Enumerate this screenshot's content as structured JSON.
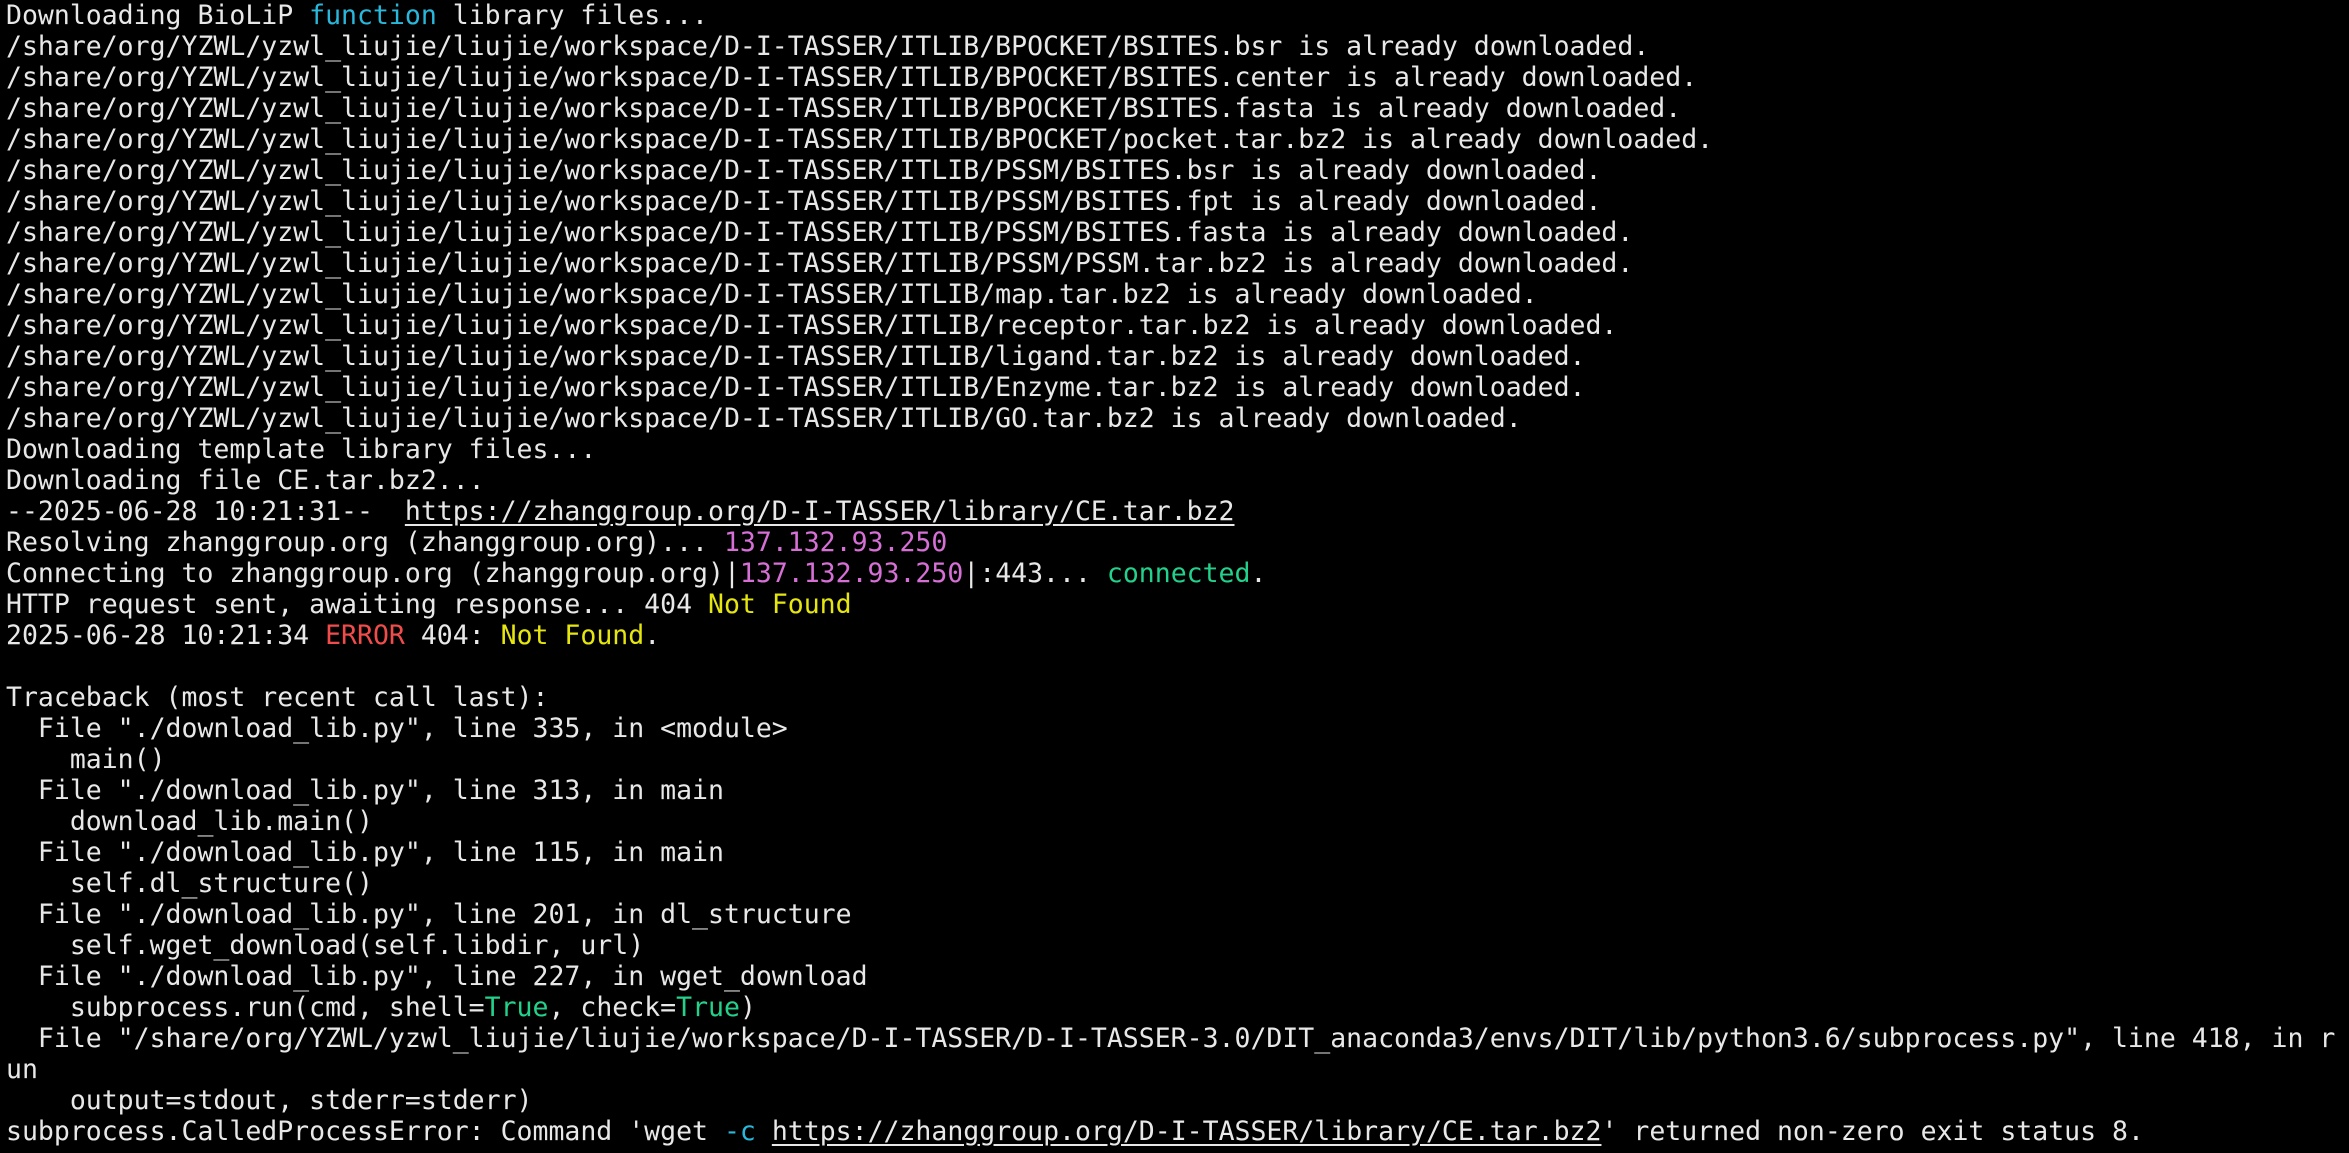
{
  "terminal": {
    "colors": {
      "background": "#000000",
      "foreground": "#e8e8e8",
      "cyan": "#29b8db",
      "magenta": "#d670d6",
      "green": "#23d18b",
      "yellow": "#e5e510",
      "red": "#f14c4c"
    },
    "lines": [
      [
        {
          "t": "Downloading BioLiP ",
          "c": "plain"
        },
        {
          "t": "function",
          "c": "cyan"
        },
        {
          "t": " library files...",
          "c": "plain"
        }
      ],
      [
        {
          "t": "/share/org/YZWL/yzwl_liujie/liujie/workspace/D-I-TASSER/ITLIB/BPOCKET/BSITES.bsr is already downloaded.",
          "c": "plain"
        }
      ],
      [
        {
          "t": "/share/org/YZWL/yzwl_liujie/liujie/workspace/D-I-TASSER/ITLIB/BPOCKET/BSITES.center is already downloaded.",
          "c": "plain"
        }
      ],
      [
        {
          "t": "/share/org/YZWL/yzwl_liujie/liujie/workspace/D-I-TASSER/ITLIB/BPOCKET/BSITES.fasta is already downloaded.",
          "c": "plain"
        }
      ],
      [
        {
          "t": "/share/org/YZWL/yzwl_liujie/liujie/workspace/D-I-TASSER/ITLIB/BPOCKET/pocket.tar.bz2 is already downloaded.",
          "c": "plain"
        }
      ],
      [
        {
          "t": "/share/org/YZWL/yzwl_liujie/liujie/workspace/D-I-TASSER/ITLIB/PSSM/BSITES.bsr is already downloaded.",
          "c": "plain"
        }
      ],
      [
        {
          "t": "/share/org/YZWL/yzwl_liujie/liujie/workspace/D-I-TASSER/ITLIB/PSSM/BSITES.fpt is already downloaded.",
          "c": "plain"
        }
      ],
      [
        {
          "t": "/share/org/YZWL/yzwl_liujie/liujie/workspace/D-I-TASSER/ITLIB/PSSM/BSITES.fasta is already downloaded.",
          "c": "plain"
        }
      ],
      [
        {
          "t": "/share/org/YZWL/yzwl_liujie/liujie/workspace/D-I-TASSER/ITLIB/PSSM/PSSM.tar.bz2 is already downloaded.",
          "c": "plain"
        }
      ],
      [
        {
          "t": "/share/org/YZWL/yzwl_liujie/liujie/workspace/D-I-TASSER/ITLIB/map.tar.bz2 is already downloaded.",
          "c": "plain"
        }
      ],
      [
        {
          "t": "/share/org/YZWL/yzwl_liujie/liujie/workspace/D-I-TASSER/ITLIB/receptor.tar.bz2 is already downloaded.",
          "c": "plain"
        }
      ],
      [
        {
          "t": "/share/org/YZWL/yzwl_liujie/liujie/workspace/D-I-TASSER/ITLIB/ligand.tar.bz2 is already downloaded.",
          "c": "plain"
        }
      ],
      [
        {
          "t": "/share/org/YZWL/yzwl_liujie/liujie/workspace/D-I-TASSER/ITLIB/Enzyme.tar.bz2 is already downloaded.",
          "c": "plain"
        }
      ],
      [
        {
          "t": "/share/org/YZWL/yzwl_liujie/liujie/workspace/D-I-TASSER/ITLIB/GO.tar.bz2 is already downloaded.",
          "c": "plain"
        }
      ],
      [
        {
          "t": "Downloading template library files...",
          "c": "plain"
        }
      ],
      [
        {
          "t": "Downloading file CE.tar.bz2...",
          "c": "plain"
        }
      ],
      [
        {
          "t": "--2025-06-28 10:21:31--  ",
          "c": "plain"
        },
        {
          "t": "https://zhanggroup.org/D-I-TASSER/library/CE.tar.bz2",
          "c": "link"
        }
      ],
      [
        {
          "t": "Resolving zhanggroup.org (zhanggroup.org)... ",
          "c": "plain"
        },
        {
          "t": "137.132.93.250",
          "c": "magenta"
        }
      ],
      [
        {
          "t": "Connecting to zhanggroup.org (zhanggroup.org)|",
          "c": "plain"
        },
        {
          "t": "137.132.93.250",
          "c": "magenta"
        },
        {
          "t": "|:443... ",
          "c": "plain"
        },
        {
          "t": "connected",
          "c": "green"
        },
        {
          "t": ".",
          "c": "plain"
        }
      ],
      [
        {
          "t": "HTTP request sent, awaiting response... 404 ",
          "c": "plain"
        },
        {
          "t": "Not Found",
          "c": "yellow"
        }
      ],
      [
        {
          "t": "2025-06-28 10:21:34 ",
          "c": "plain"
        },
        {
          "t": "ERROR",
          "c": "red"
        },
        {
          "t": " 404: ",
          "c": "plain"
        },
        {
          "t": "Not Found",
          "c": "yellow"
        },
        {
          "t": ".",
          "c": "plain"
        }
      ],
      [
        {
          "t": "",
          "c": "plain"
        }
      ],
      [
        {
          "t": "Traceback (most recent call last):",
          "c": "plain"
        }
      ],
      [
        {
          "t": "  File \"./download_lib.py\", line 335, in <module>",
          "c": "plain"
        }
      ],
      [
        {
          "t": "    main()",
          "c": "plain"
        }
      ],
      [
        {
          "t": "  File \"./download_lib.py\", line 313, in main",
          "c": "plain"
        }
      ],
      [
        {
          "t": "    download_lib.main()",
          "c": "plain"
        }
      ],
      [
        {
          "t": "  File \"./download_lib.py\", line 115, in main",
          "c": "plain"
        }
      ],
      [
        {
          "t": "    self.dl_structure()",
          "c": "plain"
        }
      ],
      [
        {
          "t": "  File \"./download_lib.py\", line 201, in dl_structure",
          "c": "plain"
        }
      ],
      [
        {
          "t": "    self.wget_download(self.libdir, url)",
          "c": "plain"
        }
      ],
      [
        {
          "t": "  File \"./download_lib.py\", line 227, in wget_download",
          "c": "plain"
        }
      ],
      [
        {
          "t": "    subprocess.run(cmd, shell=",
          "c": "plain"
        },
        {
          "t": "True",
          "c": "green"
        },
        {
          "t": ", check=",
          "c": "plain"
        },
        {
          "t": "True",
          "c": "green"
        },
        {
          "t": ")",
          "c": "plain"
        }
      ],
      [
        {
          "t": "  File \"/share/org/YZWL/yzwl_liujie/liujie/workspace/D-I-TASSER/D-I-TASSER-3.0/DIT_anaconda3/envs/DIT/lib/python3.6/subprocess.py\", line 418, in r",
          "c": "plain"
        }
      ],
      [
        {
          "t": "un",
          "c": "plain"
        }
      ],
      [
        {
          "t": "    output=stdout, stderr=stderr)",
          "c": "plain"
        }
      ],
      [
        {
          "t": "subprocess.CalledProcessError: Command 'wget ",
          "c": "plain"
        },
        {
          "t": "-c",
          "c": "cyan"
        },
        {
          "t": " ",
          "c": "plain"
        },
        {
          "t": "https://zhanggroup.org/D-I-TASSER/library/CE.tar.bz2",
          "c": "link"
        },
        {
          "t": "' returned non-zero exit status 8.",
          "c": "plain"
        }
      ]
    ]
  }
}
